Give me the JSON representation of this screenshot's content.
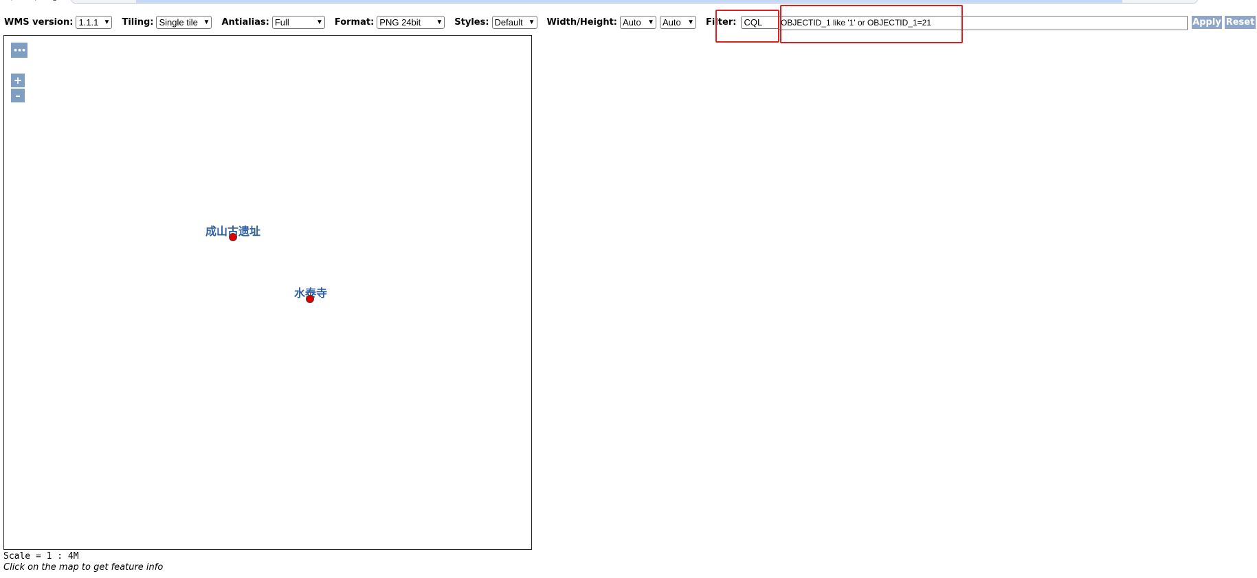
{
  "toolbar": {
    "wms_version": {
      "label": "WMS version:",
      "value": "1.1.1"
    },
    "tiling": {
      "label": "Tiling:",
      "value": "Single tile"
    },
    "antialias": {
      "label": "Antialias:",
      "value": "Full"
    },
    "format": {
      "label": "Format:",
      "value": "PNG 24bit"
    },
    "styles": {
      "label": "Styles:",
      "value": "Default"
    },
    "width_height": {
      "label": "Width/Height:",
      "width_value": "Auto",
      "height_value": "Auto"
    },
    "filter": {
      "label": "Filter:",
      "type_value": "CQL",
      "expression": "OBJECTID_1 like '1' or OBJECTID_1=21"
    },
    "apply_label": "Apply",
    "reset_label": "Reset"
  },
  "map": {
    "controls": {
      "layer_switcher": "•••",
      "zoom_in": "+",
      "zoom_out": "–"
    },
    "features": [
      {
        "label": "成山古遗址"
      },
      {
        "label": "水泰寺"
      }
    ]
  },
  "status": {
    "scale": "Scale = 1 : 4M",
    "hint": "Click on the map to get feature info"
  },
  "colors": {
    "highlight": "#e01e1e",
    "button": "#8ea6c7",
    "marker": "#e00000",
    "label": "#2d5fa0"
  }
}
